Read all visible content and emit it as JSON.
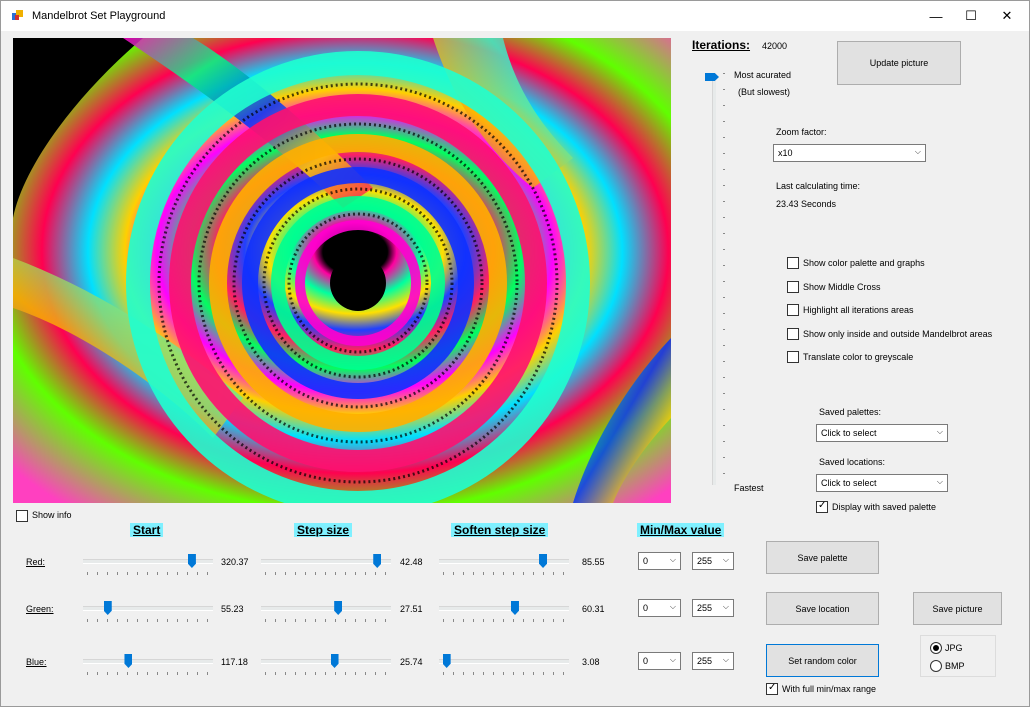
{
  "window": {
    "title": "Mandelbrot Set Playground",
    "minimize": "—",
    "maximize": "☐",
    "close": "✕"
  },
  "iterations": {
    "label": "Iterations:",
    "value": "42000",
    "top_label": "Most acurated",
    "top_sub": "(But slowest)",
    "bottom_label": "Fastest",
    "slider_position": 1.0
  },
  "update_button": "Update picture",
  "zoom": {
    "label": "Zoom factor:",
    "value": "x10"
  },
  "calc": {
    "label": "Last calculating time:",
    "value": "23.43 Seconds"
  },
  "checkboxes": [
    {
      "label": "Show color palette and graphs",
      "checked": false
    },
    {
      "label": "Show Middle Cross",
      "checked": false
    },
    {
      "label": "Highlight all iterations areas",
      "checked": false
    },
    {
      "label": "Show only inside and outside Mandelbrot areas",
      "checked": false
    },
    {
      "label": "Translate color to greyscale",
      "checked": false
    }
  ],
  "saved_palettes": {
    "label": "Saved palettes:",
    "value": "Click to select"
  },
  "saved_locations": {
    "label": "Saved locations:",
    "value": "Click to select"
  },
  "display_saved_palette": {
    "label": "Display with saved palette",
    "checked": true
  },
  "show_info": {
    "label": "Show info",
    "checked": false
  },
  "headers": {
    "start": "Start",
    "step": "Step size",
    "soften": "Soften step size",
    "minmax": "Min/Max value"
  },
  "rows": [
    {
      "label": "Red:",
      "start": "320.37",
      "start_pos": 0.86,
      "step": "42.48",
      "step_pos": 0.92,
      "soften": "85.55",
      "soften_pos": 0.82,
      "min": "0",
      "max": "255"
    },
    {
      "label": "Green:",
      "start": "55.23",
      "start_pos": 0.17,
      "step": "27.51",
      "step_pos": 0.6,
      "soften": "60.31",
      "soften_pos": 0.59,
      "min": "0",
      "max": "255"
    },
    {
      "label": "Blue:",
      "start": "117.18",
      "start_pos": 0.34,
      "step": "25.74",
      "step_pos": 0.57,
      "soften": "3.08",
      "soften_pos": 0.03,
      "min": "0",
      "max": "255"
    }
  ],
  "buttons": {
    "save_palette": "Save  palette",
    "save_location": "Save location",
    "save_picture": "Save picture",
    "random_color": "Set random color"
  },
  "full_range": {
    "label": "With full min/max range",
    "checked": true
  },
  "format": [
    {
      "label": "JPG",
      "selected": true
    },
    {
      "label": "BMP",
      "selected": false
    }
  ],
  "colors": {
    "accent": "#0078d7",
    "header_bg": "#7ff0ff"
  }
}
